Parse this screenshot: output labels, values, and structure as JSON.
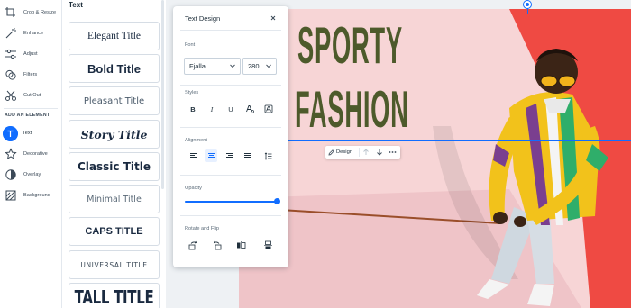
{
  "tools": [
    {
      "label": "Crop & Resize",
      "icon": "crop-icon",
      "active": false
    },
    {
      "label": "Enhance",
      "icon": "magic-wand-icon",
      "active": false
    },
    {
      "label": "Adjust",
      "icon": "sliders-icon",
      "active": false
    },
    {
      "label": "Filters",
      "icon": "filters-icon",
      "active": false
    },
    {
      "label": "Cut Out",
      "icon": "scissors-icon",
      "active": false
    }
  ],
  "add_element_heading": "ADD AN ELEMENT",
  "elements": [
    {
      "label": "Text",
      "icon": "text-icon",
      "active": true
    },
    {
      "label": "Decorative",
      "icon": "decorative-icon",
      "active": false
    },
    {
      "label": "Overlay",
      "icon": "overlay-icon",
      "active": false
    },
    {
      "label": "Background",
      "icon": "background-icon",
      "active": false
    }
  ],
  "text_panel": {
    "title": "Text",
    "presets": [
      "Elegant Title",
      "Bold Title",
      "Pleasant Title",
      "Story Title",
      "Classic Title",
      "Minimal Title",
      "CAPS TITLE",
      "UNIVERSAL TITLE",
      "TALL TITLE"
    ]
  },
  "text_design": {
    "title": "Text Design",
    "close_icon": "close-icon",
    "font_label": "Font",
    "font_value": "Fjalla",
    "size_value": "280",
    "styles_label": "Styles",
    "style_buttons": [
      "B",
      "I",
      "U"
    ],
    "alignment_label": "Alignment",
    "alignment_selected": "center",
    "opacity_label": "Opacity",
    "opacity": 1.0,
    "rotate_label": "Rotate and Flip"
  },
  "element_toolbar": {
    "design_label": "Design"
  },
  "canvas_text": {
    "line1": "SPORTY",
    "line2": "FASHION"
  },
  "colors": {
    "accent": "#116dff",
    "title_text": "#4d5a2b",
    "photo_bg": "#f6d5d7",
    "jacket_yellow": "#f2c21b"
  }
}
